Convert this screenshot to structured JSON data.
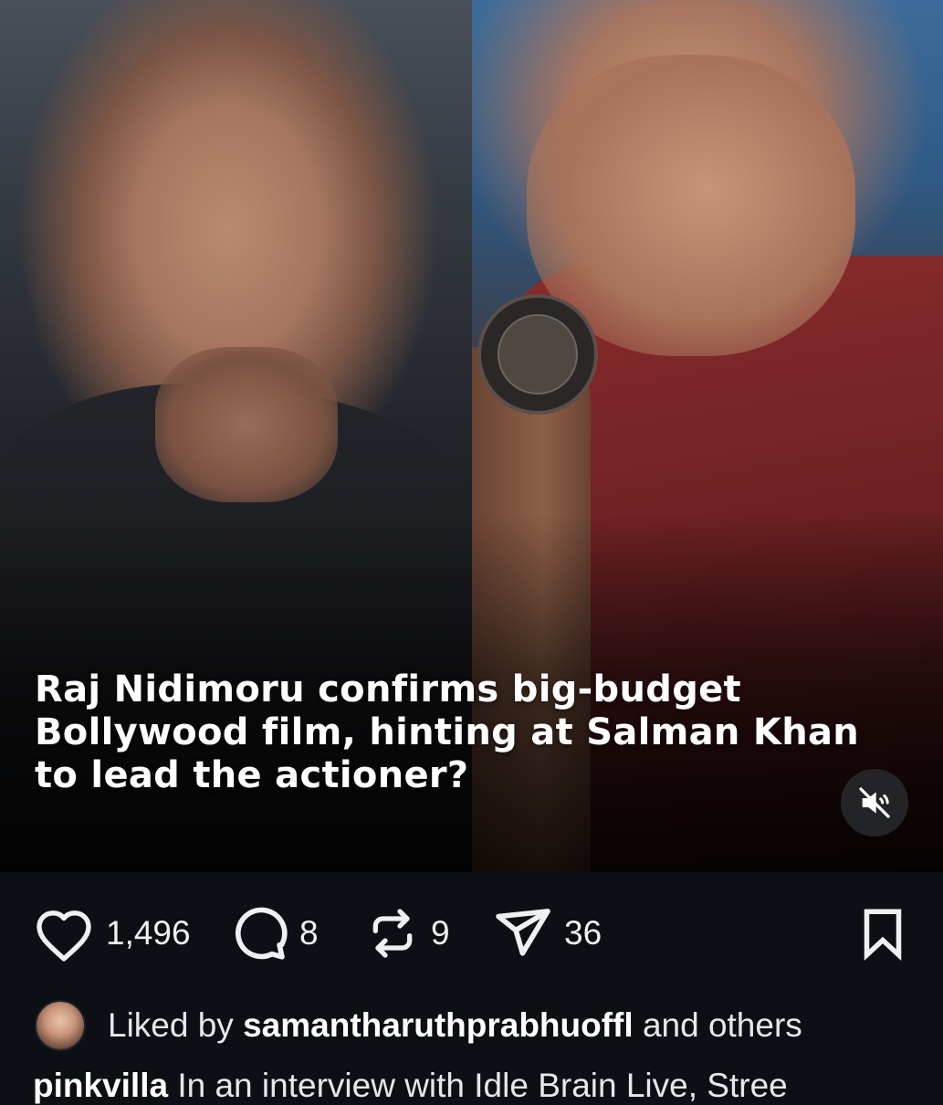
{
  "post": {
    "headline": "Raj Nidimoru confirms big-budget Bollywood film, hinting at Salman Khan to lead the actioner?",
    "media_description": "Split photo of two men"
  },
  "controls": {
    "mute_icon": "speaker-muted-icon"
  },
  "actions": {
    "like": {
      "icon": "heart-icon",
      "count": "1,496"
    },
    "comment": {
      "icon": "comment-bubble-icon",
      "count": "8"
    },
    "repost": {
      "icon": "repost-arrows-icon",
      "count": "9"
    },
    "share": {
      "icon": "send-paper-plane-icon",
      "count": "36"
    },
    "save": {
      "icon": "bookmark-icon"
    }
  },
  "liked_by": {
    "prefix": "Liked by",
    "username": "samantharuthprabhuoffl",
    "suffix": "and others"
  },
  "caption": {
    "username": "pinkvilla",
    "text": "In an interview with Idle Brain Live, Stree"
  },
  "colors": {
    "background": "#0c0f14",
    "text": "#eef0f3"
  }
}
